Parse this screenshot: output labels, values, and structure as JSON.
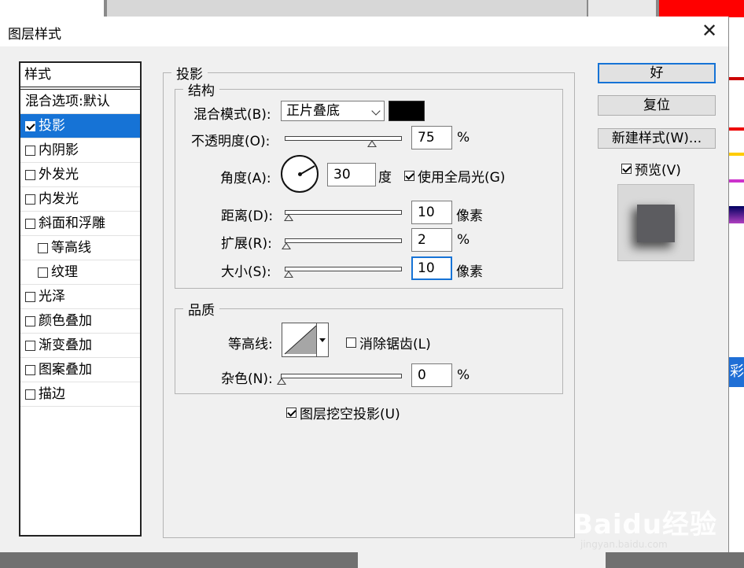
{
  "dialog": {
    "title": "图层样式",
    "close_icon": "close-icon"
  },
  "styles_panel": {
    "header": "样式",
    "blend_options": "混合选项:默认",
    "items": [
      {
        "label": "投影",
        "checked": true,
        "selected": true,
        "indent": false
      },
      {
        "label": "内阴影",
        "checked": false,
        "selected": false,
        "indent": false
      },
      {
        "label": "外发光",
        "checked": false,
        "selected": false,
        "indent": false
      },
      {
        "label": "内发光",
        "checked": false,
        "selected": false,
        "indent": false
      },
      {
        "label": "斜面和浮雕",
        "checked": false,
        "selected": false,
        "indent": false
      },
      {
        "label": "等高线",
        "checked": false,
        "selected": false,
        "indent": true
      },
      {
        "label": "纹理",
        "checked": false,
        "selected": false,
        "indent": true
      },
      {
        "label": "光泽",
        "checked": false,
        "selected": false,
        "indent": false
      },
      {
        "label": "颜色叠加",
        "checked": false,
        "selected": false,
        "indent": false
      },
      {
        "label": "渐变叠加",
        "checked": false,
        "selected": false,
        "indent": false
      },
      {
        "label": "图案叠加",
        "checked": false,
        "selected": false,
        "indent": false
      },
      {
        "label": "描边",
        "checked": false,
        "selected": false,
        "indent": false
      }
    ]
  },
  "drop_shadow": {
    "group_title": "投影",
    "structure": {
      "title": "结构",
      "blend_mode_label": "混合模式(B):",
      "blend_mode_value": "正片叠底",
      "shadow_color": "#000000",
      "opacity_label": "不透明度(O):",
      "opacity_value": "75",
      "opacity_unit": "%",
      "opacity_level": 75,
      "angle_label": "角度(A):",
      "angle_value": "30",
      "angle_unit": "度",
      "global_light_label": "使用全局光(G)",
      "global_light_checked": true,
      "distance_label": "距离(D):",
      "distance_value": "10",
      "distance_unit": "像素",
      "distance_level": 3,
      "spread_label": "扩展(R):",
      "spread_value": "2",
      "spread_unit": "%",
      "spread_level": 1,
      "size_label": "大小(S):",
      "size_value": "10",
      "size_unit": "像素",
      "size_level": 3
    },
    "quality": {
      "title": "品质",
      "contour_label": "等高线:",
      "anti_alias_label": "消除锯齿(L)",
      "anti_alias_checked": false,
      "noise_label": "杂色(N):",
      "noise_value": "0",
      "noise_unit": "%",
      "noise_level": 0
    },
    "knockout_label": "图层挖空投影(U)",
    "knockout_checked": true
  },
  "buttons": {
    "ok": "好",
    "reset": "复位",
    "new_style": "新建样式(W)...",
    "preview_label": "预览(V)",
    "preview_checked": true
  },
  "background": {
    "right_tab_text": "彩工",
    "watermark": "Baidu经验",
    "watermark_url": "jingyan.baidu.com"
  }
}
